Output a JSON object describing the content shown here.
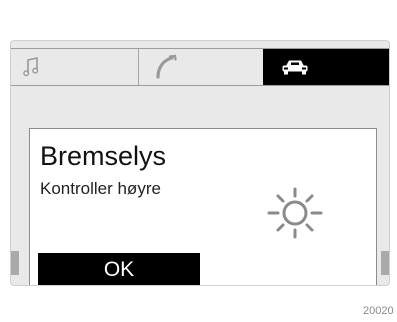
{
  "tabs": [
    {
      "icon": "music-note-icon",
      "active": false
    },
    {
      "icon": "phone-handset-icon",
      "active": false
    },
    {
      "icon": "car-icon",
      "active": true
    }
  ],
  "dialog": {
    "title": "Bremselys",
    "message": "Kontroller høyre",
    "icon": "brake-light-bulb-icon",
    "ok_label": "OK"
  },
  "footer": {
    "code": "20020"
  },
  "colors": {
    "display_bg": "#e9e9e9",
    "active_tab": "#000000",
    "button_bg": "#000000",
    "button_text": "#ffffff"
  }
}
